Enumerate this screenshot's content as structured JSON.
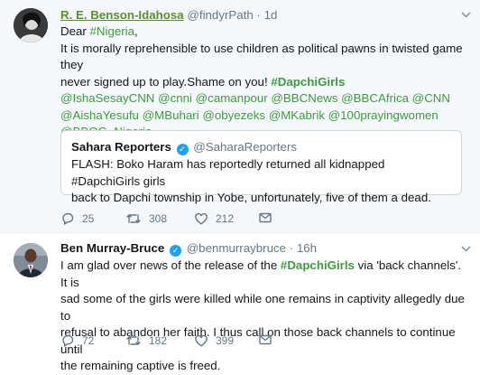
{
  "tweet1": {
    "author_name": "R. E. Benson-Idahosa",
    "handle": "@findyrPath",
    "separator": "·",
    "time": "1d",
    "lines": [
      {
        "parts": [
          [
            "t",
            "Dear "
          ],
          [
            "h",
            "#Nigeria"
          ],
          [
            "t",
            ","
          ]
        ]
      },
      {
        "parts": [
          [
            "t",
            "It is morally reprehensible to use children as political pawns in twisted game they"
          ]
        ]
      },
      {
        "parts": [
          [
            "t",
            "never signed up to play.Shame on you!  "
          ],
          [
            "hb",
            "#DapchiGirls"
          ]
        ]
      },
      {
        "parts": [
          [
            "m",
            "@IshaSesayCNN @cnni @camanpour @BBCNews @BBCAfrica @CNN"
          ]
        ]
      },
      {
        "parts": [
          [
            "m",
            "@AishaYesufu @MBuhari @obyezeks @MKabrik @100prayingwomen"
          ]
        ]
      },
      {
        "parts": [
          [
            "m",
            "@BBOG_Nigeria"
          ]
        ]
      }
    ],
    "quote": {
      "name": "Sahara Reporters",
      "handle": "@SaharaReporters",
      "line1": "FLASH: Boko Haram has reportedly returned all kidnapped #DapchiGirls girls",
      "line2": "back to Dapchi township in Yobe, unfortunately, five of them a dead."
    },
    "replies": "25",
    "retweets": "308",
    "likes": "212"
  },
  "tweet2": {
    "author_name": "Ben Murray-Bruce",
    "handle": "@benmurraybruce",
    "separator": "·",
    "time": "16h",
    "lines": [
      {
        "parts": [
          [
            "t",
            "I am glad over news of the release of the "
          ],
          [
            "hb",
            "#DapchiGirls"
          ],
          [
            "t",
            " via 'back channels'. It is"
          ]
        ]
      },
      {
        "parts": [
          [
            "t",
            "sad some of the girls were killed while one remains in captivity allegedly due to"
          ]
        ]
      },
      {
        "parts": [
          [
            "t",
            "refusal to abandon her faith. I thus call on those back channels to continue until"
          ]
        ]
      },
      {
        "parts": [
          [
            "t",
            "the remaining captive is freed."
          ]
        ]
      }
    ],
    "replies": "72",
    "retweets": "182",
    "likes": "399"
  },
  "icons": {
    "reply": "reply-icon",
    "retweet": "retweet-icon",
    "like": "heart-icon",
    "message": "envelope-icon",
    "verified": "verified-badge-icon",
    "caret": "chevron-down-icon"
  },
  "colors": {
    "hashtag": "#3e9a3e",
    "verified": "#1da1f2",
    "meta": "#657786"
  }
}
